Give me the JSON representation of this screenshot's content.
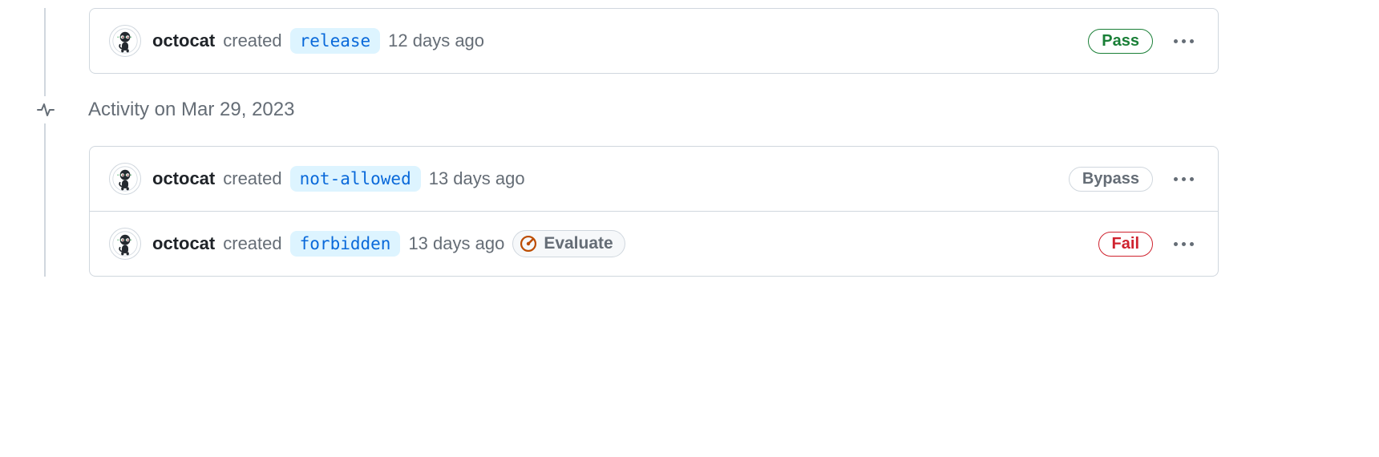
{
  "groups": [
    {
      "date_header": null,
      "rows": [
        {
          "username": "octocat",
          "action": "created",
          "branch": "release",
          "timestamp": "12 days ago",
          "evaluate": null,
          "status": {
            "label": "Pass",
            "class": "status-pass"
          }
        }
      ]
    },
    {
      "date_header": "Activity on Mar 29, 2023",
      "rows": [
        {
          "username": "octocat",
          "action": "created",
          "branch": "not-allowed",
          "timestamp": "13 days ago",
          "evaluate": null,
          "status": {
            "label": "Bypass",
            "class": "status-bypass"
          }
        },
        {
          "username": "octocat",
          "action": "created",
          "branch": "forbidden",
          "timestamp": "13 days ago",
          "evaluate": "Evaluate",
          "status": {
            "label": "Fail",
            "class": "status-fail"
          }
        }
      ]
    }
  ]
}
